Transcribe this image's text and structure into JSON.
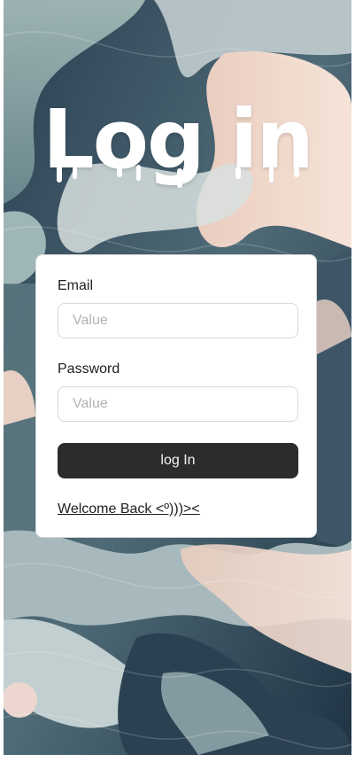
{
  "header": {
    "title": "Log in"
  },
  "form": {
    "email": {
      "label": "Email",
      "placeholder": "Value",
      "value": ""
    },
    "password": {
      "label": "Password",
      "placeholder": "Value",
      "value": ""
    },
    "submit_label": "log In",
    "welcome_link": "Welcome Back <º)))><"
  },
  "colors": {
    "card_background": "#ffffff",
    "card_border": "#d9d9d9",
    "button_background": "#2c2c2c",
    "button_text": "#f5f5f5",
    "title_color": "#ffffff",
    "text_color": "#1e1e1e",
    "placeholder_color": "#b3b3b3"
  },
  "background": {
    "description_icon": "abstract-wave-art"
  }
}
